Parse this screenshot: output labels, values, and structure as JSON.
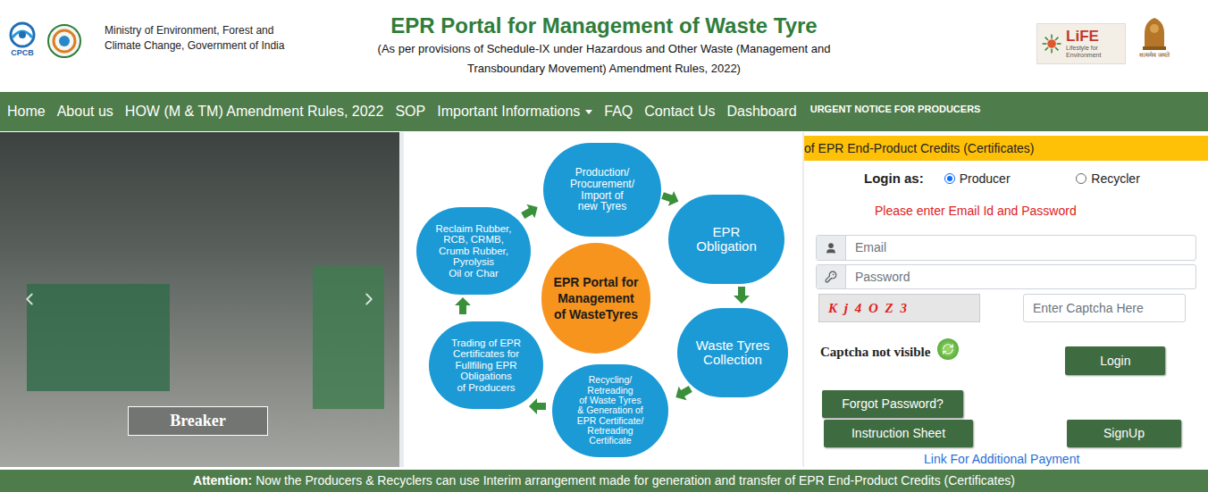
{
  "header": {
    "cpcb_label": "CPCB",
    "ministry_lines": [
      "Ministry of Environment, Forest and",
      "Climate Change, Government of India"
    ],
    "title": "EPR Portal for Management of Waste Tyre",
    "subtitle_lines": [
      "(As per provisions of Schedule-IX under Hazardous and Other Waste (Management and",
      "Transboundary Movement) Amendment Rules, 2022)"
    ],
    "life_logo": {
      "title": "LiFE",
      "tagline": "Lifestyle for Environment"
    },
    "emblem_caption": "सत्यमेव जयते"
  },
  "nav": {
    "items": [
      {
        "label": "Home",
        "dropdown": false
      },
      {
        "label": "About us",
        "dropdown": false
      },
      {
        "label": "HOW (M & TM) Amendment Rules, 2022",
        "dropdown": false
      },
      {
        "label": "SOP",
        "dropdown": false
      },
      {
        "label": "Important Informations",
        "dropdown": true
      },
      {
        "label": "FAQ",
        "dropdown": false
      },
      {
        "label": "Contact Us",
        "dropdown": false
      },
      {
        "label": "Dashboard",
        "dropdown": false
      }
    ],
    "notice": "URGENT NOTICE FOR PRODUCERS"
  },
  "carousel": {
    "caption": "Breaker"
  },
  "diagram": {
    "center": [
      "EPR Portal for",
      "Management",
      "of WasteTyres"
    ],
    "nodes": [
      {
        "lines": [
          "Production/",
          "Procurement/",
          "Import of",
          "new Tyres"
        ]
      },
      {
        "lines": [
          "EPR",
          "Obligation"
        ]
      },
      {
        "lines": [
          "Waste Tyres",
          "Collection"
        ]
      },
      {
        "lines": [
          "Recycling/",
          "Retreading",
          "of Waste Tyres",
          "& Generation of",
          "EPR Certificate/",
          "Retreading",
          "Certificate"
        ]
      },
      {
        "lines": [
          "Trading of EPR",
          "Certificates for",
          "Fullfiling EPR",
          "Obligations",
          "of Producers"
        ]
      },
      {
        "lines": [
          "Reclaim Rubber,",
          "RCB, CRMB,",
          "Crumb Rubber,",
          "Pyrolysis",
          "Oil or Char"
        ]
      }
    ]
  },
  "login": {
    "marquee": "of EPR End-Product Credits (Certificates)",
    "login_as": "Login as:",
    "roles": [
      {
        "label": "Producer",
        "selected": true
      },
      {
        "label": "Recycler",
        "selected": false
      }
    ],
    "error": "Please enter Email Id and Password",
    "email_placeholder": "Email",
    "password_placeholder": "Password",
    "captcha": "K j 4 O Z 3",
    "captcha_placeholder": "Enter Captcha Here",
    "captcha_hint": "Captcha not visible",
    "login_button": "Login",
    "forgot_button": "Forgot Password?",
    "instruction_button": "Instruction Sheet",
    "signup_button": "SignUp",
    "payment_link": "Link For Additional Payment"
  },
  "footer": {
    "label": "Attention:",
    "text": "Now the Producers & Recyclers can use Interim arrangement made for generation and transfer of EPR End-Product Credits (Certificates)"
  }
}
